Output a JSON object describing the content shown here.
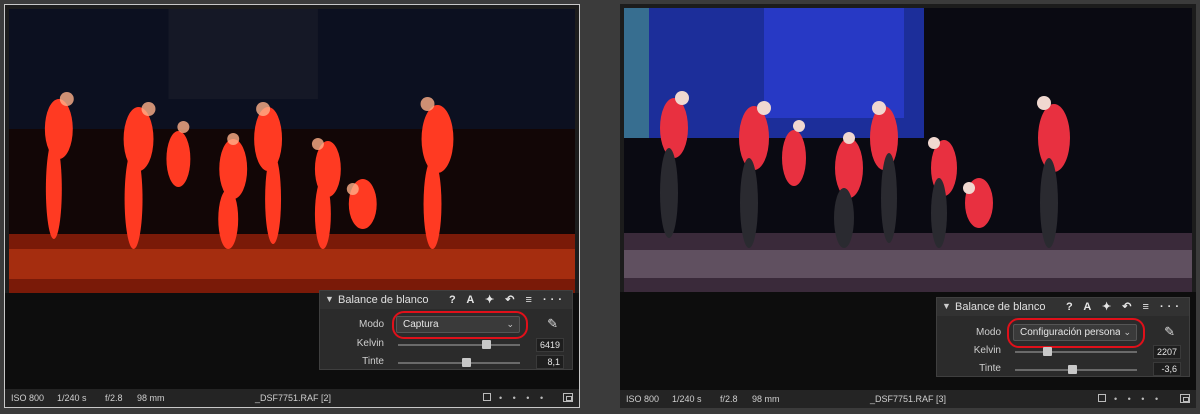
{
  "left": {
    "panel_title": "Balance de blanco",
    "mode_label": "Modo",
    "mode_value": "Captura",
    "kelvin_label": "Kelvin",
    "kelvin_value": "6419",
    "kelvin_level": 0.72,
    "tint_label": "Tinte",
    "tint_value": "8,1",
    "tint_level": 0.56,
    "status": {
      "iso": "ISO 800",
      "shutter": "1/240 s",
      "aperture": "f/2.8",
      "focal": "98 mm",
      "filename": "_DSF7751.RAF [2]"
    }
  },
  "right": {
    "panel_title": "Balance de blanco",
    "mode_label": "Modo",
    "mode_value": "Configuración personal...",
    "kelvin_label": "Kelvin",
    "kelvin_value": "2207",
    "kelvin_level": 0.26,
    "tint_label": "Tinte",
    "tint_value": "-3,6",
    "tint_level": 0.47,
    "status": {
      "iso": "ISO 800",
      "shutter": "1/240 s",
      "aperture": "f/2.8",
      "focal": "98 mm",
      "filename": "_DSF7751.RAF [3]"
    }
  },
  "panel_tools": "? A ✦ ↶ ≡ ···",
  "status_dots": "• • • •",
  "icons": [
    "chevron-down-icon",
    "help-icon",
    "auto-icon",
    "pin-icon",
    "undo-icon",
    "menu-icon",
    "more-icon",
    "eyedropper-icon",
    "square-icon",
    "grid-icon"
  ],
  "colors": {
    "highlight": "#e0101a",
    "warm_tone": "#ff3a20",
    "cool_tone": "#2a3cd0"
  }
}
